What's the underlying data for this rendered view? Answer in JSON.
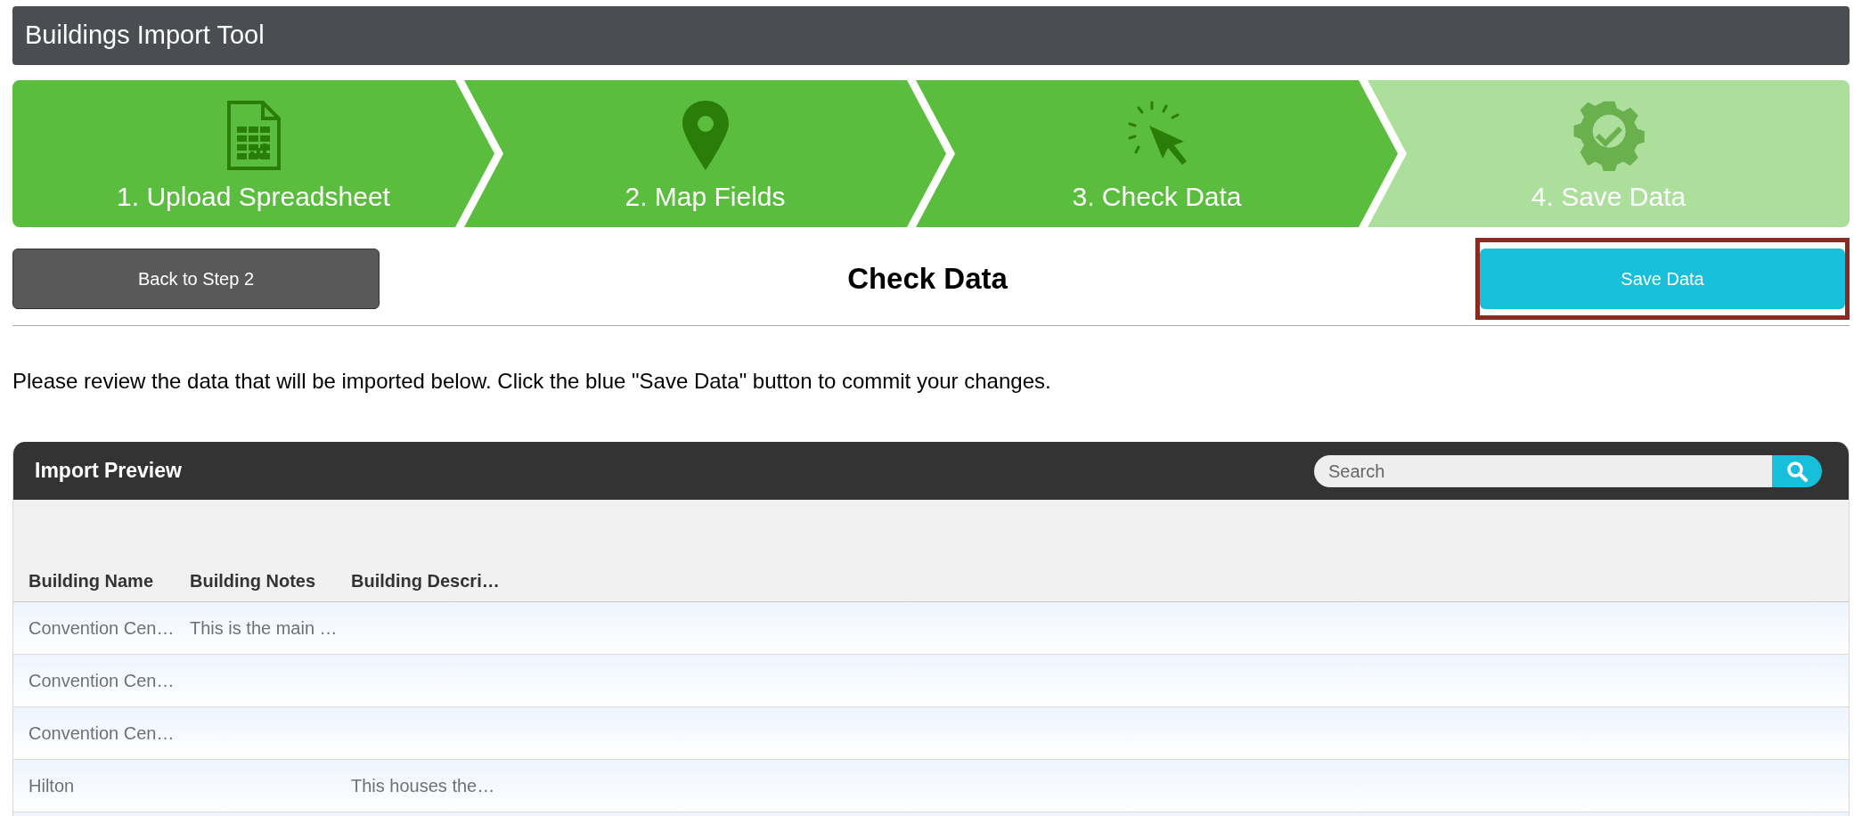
{
  "header": {
    "title": "Buildings Import Tool"
  },
  "steps": [
    {
      "kind": "spreadsheet",
      "label": "1. Upload Spreadsheet",
      "active": true
    },
    {
      "kind": "pin",
      "label": "2. Map Fields",
      "active": true
    },
    {
      "kind": "click",
      "label": "3. Check Data",
      "active": true
    },
    {
      "kind": "gear",
      "label": "4. Save Data",
      "active": false
    }
  ],
  "toolbar": {
    "back_button": "Back to Step 2",
    "heading": "Check Data",
    "save_button": {
      "label": "Save Data",
      "highlighted": true
    }
  },
  "instructions": "Please review the data that will be imported below. Click the blue \"Save Data\" button to commit your changes.",
  "preview": {
    "title": "Import Preview",
    "search": {
      "placeholder": "Search"
    },
    "columns": [
      "Building Name",
      "Building Notes",
      "Building Descri…"
    ],
    "rows": [
      [
        "Convention Cen…",
        "This is the main …",
        ""
      ],
      [
        "Convention Cen…",
        "",
        ""
      ],
      [
        "Convention Cen…",
        "",
        ""
      ],
      [
        "Hilton",
        "",
        "This houses the…"
      ]
    ]
  }
}
